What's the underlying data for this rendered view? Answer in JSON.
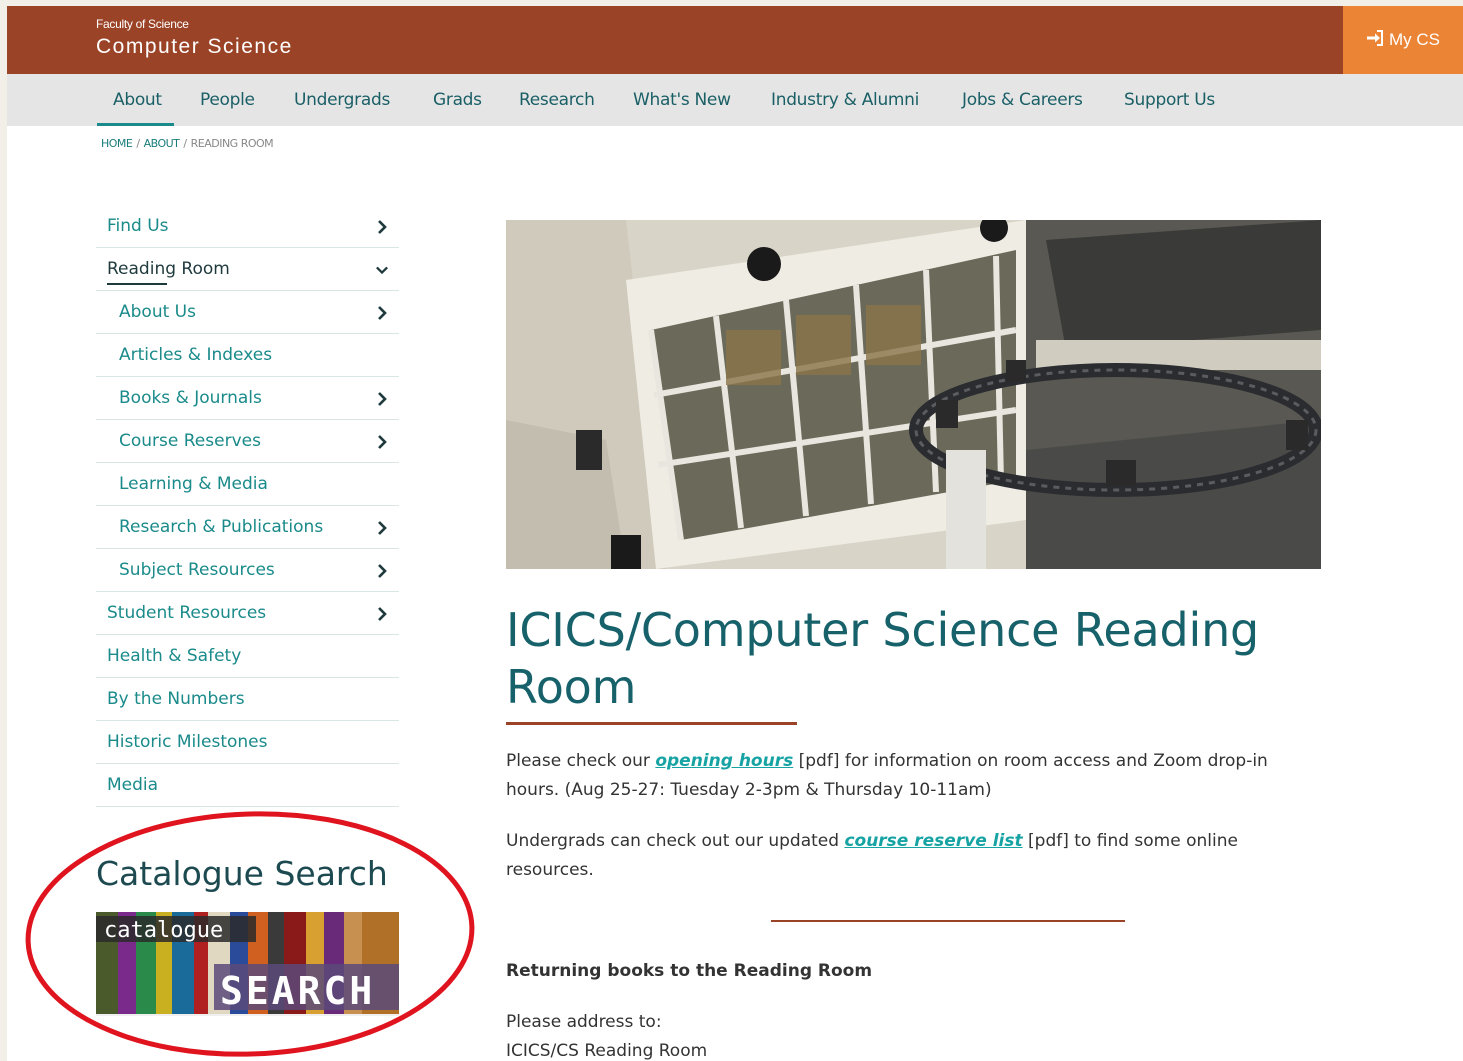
{
  "header": {
    "faculty": "Faculty of Science",
    "department": "Computer Science",
    "my_cs_label": "My CS",
    "brand_color": "#9b4326",
    "accent_color": "#ec8436"
  },
  "nav": {
    "items": [
      {
        "label": "About",
        "active": true
      },
      {
        "label": "People"
      },
      {
        "label": "Undergrads"
      },
      {
        "label": "Grads"
      },
      {
        "label": "Research"
      },
      {
        "label": "What's New"
      },
      {
        "label": "Industry & Alumni"
      },
      {
        "label": "Jobs & Careers"
      },
      {
        "label": "Support Us"
      }
    ]
  },
  "breadcrumb": {
    "home": "HOME",
    "sep": "/",
    "about": "ABOUT",
    "current": "READING ROOM"
  },
  "sidebar": {
    "items": [
      {
        "label": "Find Us",
        "icon": "chevron-right-icon"
      },
      {
        "label": "Reading Room",
        "icon": "chevron-down-icon",
        "current": true
      },
      {
        "label": "About Us",
        "icon": "chevron-right-icon",
        "sub": true
      },
      {
        "label": "Articles & Indexes",
        "sub": true
      },
      {
        "label": "Books & Journals",
        "icon": "chevron-right-icon",
        "sub": true
      },
      {
        "label": "Course Reserves",
        "icon": "chevron-right-icon",
        "sub": true
      },
      {
        "label": "Learning & Media",
        "sub": true
      },
      {
        "label": "Research & Publications",
        "icon": "chevron-right-icon",
        "sub": true
      },
      {
        "label": "Subject Resources",
        "icon": "chevron-right-icon",
        "sub": true
      },
      {
        "label": "Student Resources",
        "icon": "chevron-right-icon"
      },
      {
        "label": "Health & Safety"
      },
      {
        "label": "By the Numbers"
      },
      {
        "label": "Historic Milestones"
      },
      {
        "label": "Media"
      }
    ],
    "catalogue_heading": "Catalogue Search",
    "catalogue_banner": {
      "word_top": "catalogue",
      "word_bottom": "SEARCH"
    }
  },
  "main": {
    "title": "ICICS/Computer Science Reading Room",
    "para1": {
      "pre": "Please check our ",
      "link": "opening hours",
      "post": " [pdf] for information on room access and Zoom drop-in hours. (Aug 25-27: Tuesday 2-3pm & Thursday 10-11am)"
    },
    "para2": {
      "pre": "Undergrads can check out our updated ",
      "link": "course reserve list",
      "post": " [pdf] to find some online resources."
    },
    "returning_heading": "Returning books to the Reading Room",
    "address_intro": "Please address to:",
    "address_line1": "ICICS/CS Reading Room"
  }
}
